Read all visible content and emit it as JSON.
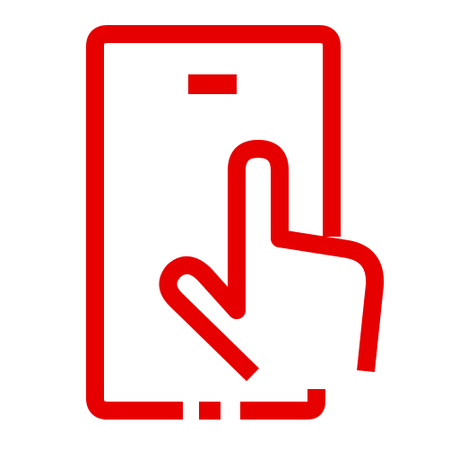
{
  "icon": {
    "name": "tap-on-phone-icon",
    "description_id": "touch-screen-phone",
    "color": "#E60000",
    "background": "#FFFFFF"
  }
}
